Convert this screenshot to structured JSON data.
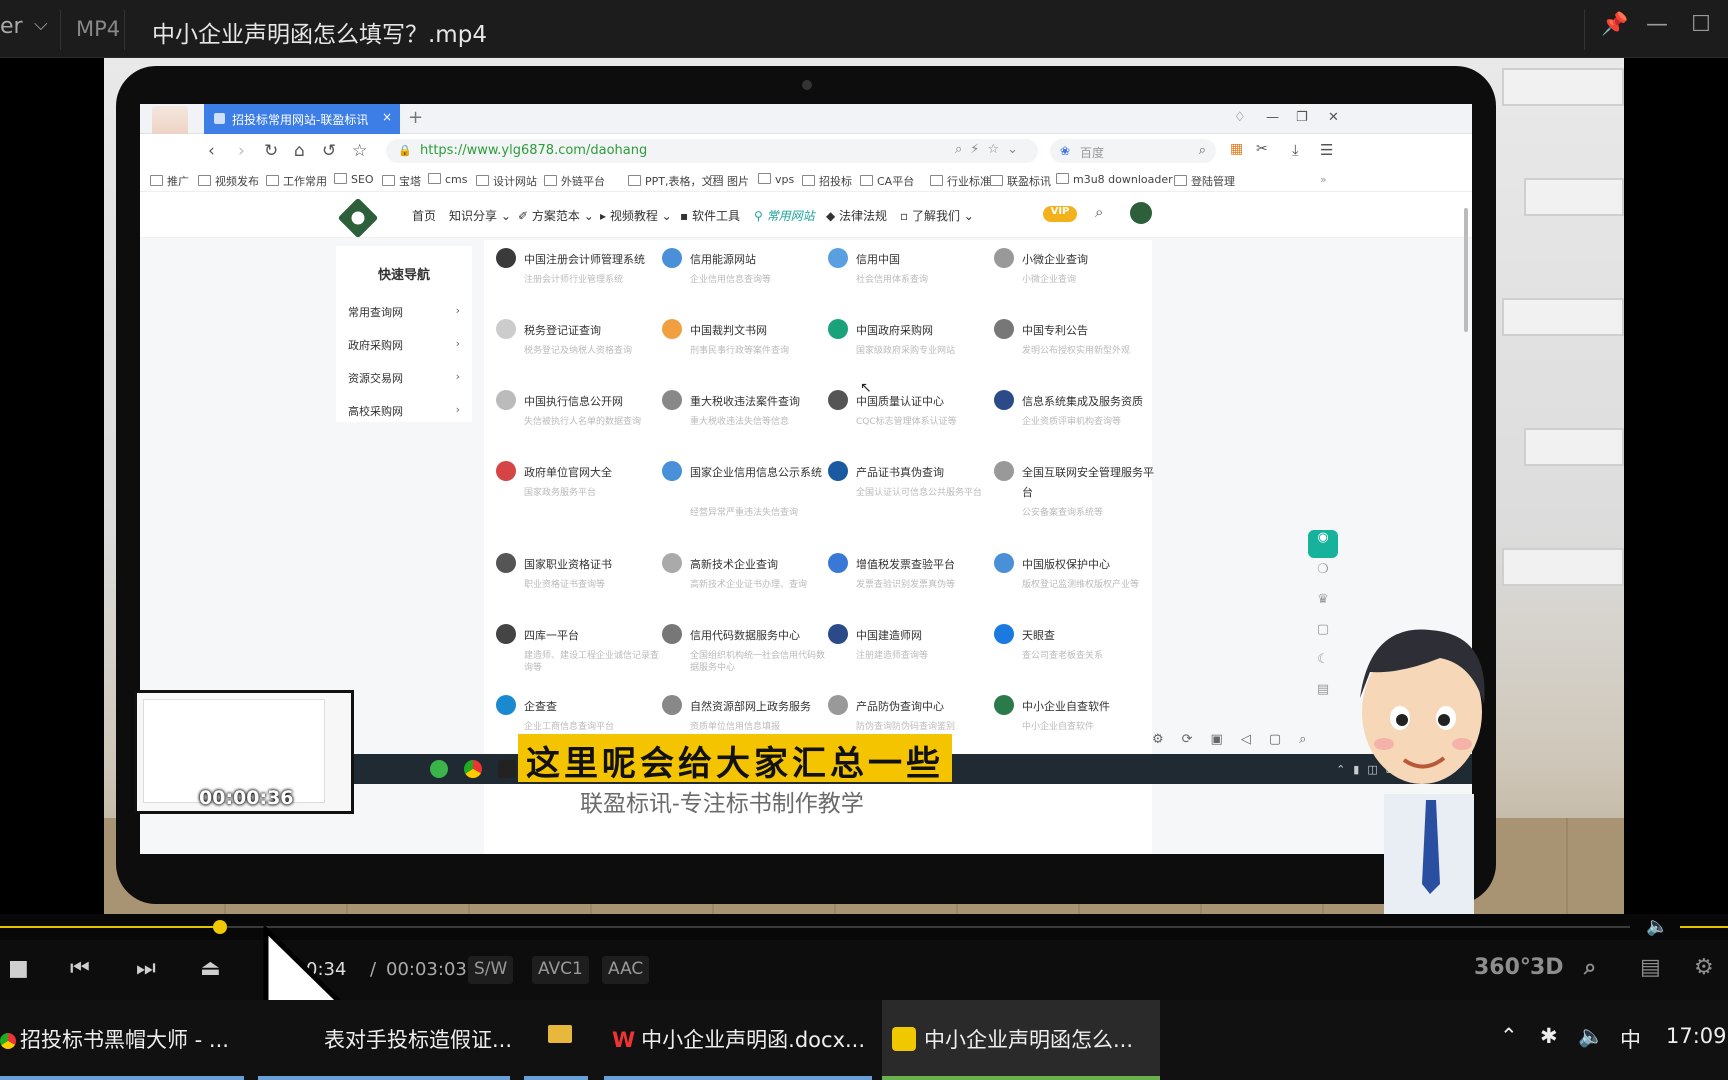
{
  "player": {
    "app_name_fragment": "er",
    "format": "MP4",
    "file_title": "中小企业声明函怎么填写？.mp4",
    "window_controls": {
      "pin": "📌",
      "minimize": "—",
      "maximize": "☐"
    }
  },
  "browser": {
    "tab_title": "招投标常用网站-联盈标讯",
    "tab_close": "×",
    "new_tab": "+",
    "url": "https://www.ylg6878.com/daohang",
    "search_placeholder": "百度",
    "bookmarks": [
      "推广",
      "视频发布",
      "工作常用",
      "SEO",
      "宝塔",
      "cms",
      "设计网站",
      "外链平台",
      "PPT,表格，文档",
      "图片",
      "vps",
      "招投标",
      "CA平台",
      "行业标准",
      "联盈标讯",
      "m3u8 downloader",
      "登陆管理"
    ],
    "bookmark_more": "»"
  },
  "site": {
    "nav": [
      "首页",
      "知识分享",
      "方案范本",
      "视频教程",
      "软件工具",
      "常用网站",
      "法律法规",
      "了解我们"
    ],
    "active_nav": "常用网站",
    "vip": "VIP",
    "sidebar_title": "快速导航",
    "sidebar_items": [
      "常用查询网",
      "政府采购网",
      "资源交易网",
      "高校采购网"
    ],
    "sidebar_arrow": "›",
    "cards": [
      {
        "name": "中国注册会计师管理系统",
        "desc": "注册会计师行业管理系统",
        "color": "#3a3a3a"
      },
      {
        "name": "信用能源网站",
        "desc": "企业信用信息查询等",
        "color": "#4a90d9"
      },
      {
        "name": "信用中国",
        "desc": "社会信用体系查询",
        "color": "#5aa0e0"
      },
      {
        "name": "小微企业查询",
        "desc": "小微企业查询",
        "color": "#999999"
      },
      {
        "name": "税务登记证查询",
        "desc": "税务登记及纳税人资格查询",
        "color": "#cccccc"
      },
      {
        "name": "中国裁判文书网",
        "desc": "刑事民事行政等案件查询",
        "color": "#f0a040"
      },
      {
        "name": "中国政府采购网",
        "desc": "国家级政府采购专业网站",
        "color": "#1aa37a"
      },
      {
        "name": "中国专利公告",
        "desc": "发明公布授权实用新型外观",
        "color": "#777777"
      },
      {
        "name": "中国执行信息公开网",
        "desc": "失信被执行人名单的数据查询",
        "color": "#bbbbbb"
      },
      {
        "name": "重大税收违法案件查询",
        "desc": "重大税收违法失信等信息",
        "color": "#888888"
      },
      {
        "name": "中国质量认证中心",
        "desc": "CQC标志管理体系认证等",
        "color": "#555555"
      },
      {
        "name": "信息系统集成及服务资质",
        "desc": "企业资质评审机构查询等",
        "color": "#2a4a8a"
      },
      {
        "name": "政府单位官网大全",
        "desc": "国家政务服务平台",
        "color": "#d64545"
      },
      {
        "name": "国家企业信用信息公示系统",
        "desc": "经营异常严重违法失信查询",
        "color": "#4a90d9"
      },
      {
        "name": "产品证书真伪查询",
        "desc": "全国认证认可信息公共服务平台",
        "color": "#1a5aa0"
      },
      {
        "name": "全国互联网安全管理服务平台",
        "desc": "公安备案查询系统等",
        "color": "#999999"
      },
      {
        "name": "国家职业资格证书",
        "desc": "职业资格证书查询等",
        "color": "#555555"
      },
      {
        "name": "高新技术企业查询",
        "desc": "高新技术企业证书办理、查询",
        "color": "#aaaaaa"
      },
      {
        "name": "增值税发票查验平台",
        "desc": "发票查验识别发票真伪等",
        "color": "#3a78d8"
      },
      {
        "name": "中国版权保护中心",
        "desc": "版权登记监测维权版权产业等",
        "color": "#4a90d9"
      },
      {
        "name": "四库一平台",
        "desc": "建造师、建设工程企业诚信记录查询等",
        "color": "#444444"
      },
      {
        "name": "信用代码数据服务中心",
        "desc": "全国组织机构统一社会信用代码数据服务中心",
        "color": "#777777"
      },
      {
        "name": "中国建造师网",
        "desc": "注册建造师查询等",
        "color": "#2a4a8a"
      },
      {
        "name": "天眼查",
        "desc": "查公司查老板查关系",
        "color": "#1a7ae0"
      },
      {
        "name": "企查查",
        "desc": "企业工商信息查询平台",
        "color": "#1a8ad0"
      },
      {
        "name": "自然资源部网上政务服务",
        "desc": "资质单位信用信息填报",
        "color": "#888888"
      },
      {
        "name": "产品防伪查询中心",
        "desc": "防伪查询防伪码查询鉴别",
        "color": "#999999"
      },
      {
        "name": "中小企业自查软件",
        "desc": "中小企业自查软件",
        "color": "#2a7a4a"
      }
    ]
  },
  "overlay": {
    "thumb_time": "00:00:36",
    "subtitle": "这里呢会给大家汇总一些",
    "watermark": "联盈标讯-专注标书制作教学"
  },
  "playback": {
    "progress": 0.135,
    "current": "0:34",
    "separator": "/",
    "duration": "00:03:03",
    "badges": [
      "S/W",
      "AVC1",
      "AAC"
    ],
    "right_icons": [
      "360°",
      "3D",
      "⌕",
      "▤",
      "⚙"
    ]
  },
  "taskbar": {
    "tasks": [
      {
        "label": "招投标书黑帽大师 - ...",
        "icon": "chrome-icon"
      },
      {
        "label": "表对手投标造假证...",
        "icon": "app-icon"
      },
      {
        "label": "",
        "icon": "folder-icon"
      },
      {
        "label": "中小企业声明函.docx...",
        "icon": "wps-icon"
      },
      {
        "label": "中小企业声明函怎么...",
        "icon": "player-icon"
      }
    ],
    "ime": "中",
    "clock": "17:09"
  }
}
